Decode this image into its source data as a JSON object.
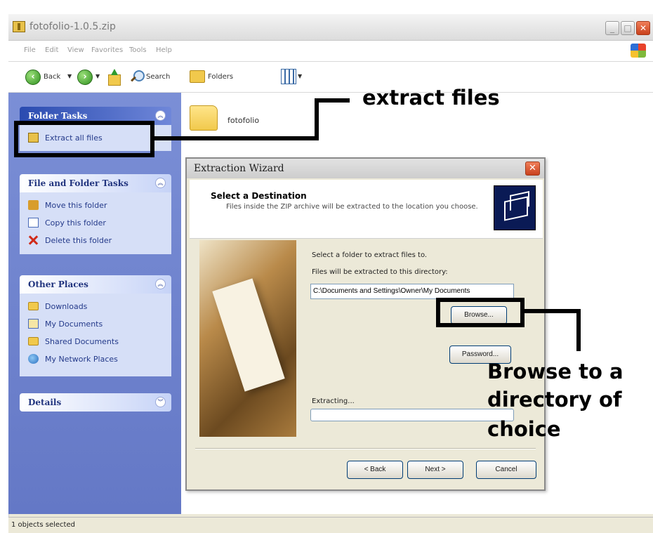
{
  "window": {
    "title": "fotofolio-1.0.5.zip",
    "menu": [
      "File",
      "Edit",
      "View",
      "Favorites",
      "Tools",
      "Help"
    ],
    "toolbar": {
      "back": "Back",
      "search": "Search",
      "folders": "Folders"
    }
  },
  "taskpane": {
    "folder_tasks": {
      "title": "Folder Tasks",
      "items": [
        {
          "label": "Extract all files",
          "icon": "zip-folder-icon"
        }
      ]
    },
    "file_folder_tasks": {
      "title": "File and Folder Tasks",
      "items": [
        {
          "label": "Move this folder",
          "icon": "move-folder-icon"
        },
        {
          "label": "Copy this folder",
          "icon": "copy-folder-icon"
        },
        {
          "label": "Delete this folder",
          "icon": "delete-icon"
        }
      ]
    },
    "other_places": {
      "title": "Other Places",
      "items": [
        {
          "label": "Downloads",
          "icon": "folder-icon"
        },
        {
          "label": "My Documents",
          "icon": "my-documents-icon"
        },
        {
          "label": "Shared Documents",
          "icon": "folder-icon"
        },
        {
          "label": "My Network Places",
          "icon": "network-icon"
        }
      ]
    },
    "details": {
      "title": "Details"
    }
  },
  "content": {
    "folder_name": "fotofolio"
  },
  "status": "1 objects selected",
  "dialog": {
    "title": "Extraction Wizard",
    "header_title": "Select a Destination",
    "header_subtitle": "Files inside the ZIP archive will be extracted to the location you choose.",
    "select_folder_label": "Select a folder to extract files to.",
    "directory_label": "Files will be extracted to this directory:",
    "directory_value": "C:\\Documents and Settings\\Owner\\My Documents",
    "browse_button": "Browse...",
    "password_button": "Password...",
    "extracting_label": "Extracting...",
    "progress": 0,
    "back_button": "< Back",
    "next_button": "Next >",
    "cancel_button": "Cancel"
  },
  "annotations": {
    "extract_label": "extract files",
    "browse_label_line1": "Browse to a",
    "browse_label_line2": "directory of",
    "browse_label_line3": "choice"
  }
}
